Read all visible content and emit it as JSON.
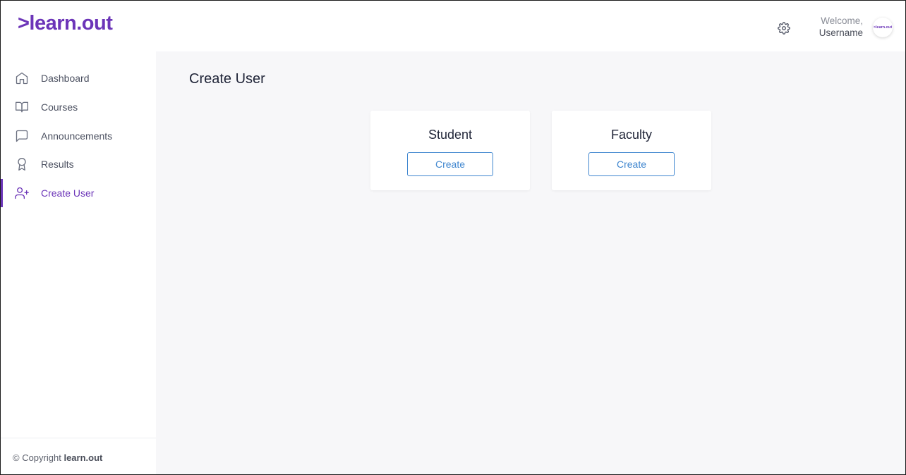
{
  "header": {
    "logo_text": ">learn.out",
    "welcome_line1": "Welcome,",
    "welcome_line2": "Username",
    "avatar_text": ">learn.out",
    "settings_icon": "gear-icon",
    "accent_color": "#6c35b8"
  },
  "sidebar": {
    "items": [
      {
        "label": "Dashboard",
        "icon": "home-icon",
        "active": false
      },
      {
        "label": "Courses",
        "icon": "book-open-icon",
        "active": false
      },
      {
        "label": "Announcements",
        "icon": "message-square-icon",
        "active": false
      },
      {
        "label": "Results",
        "icon": "award-icon",
        "active": false
      },
      {
        "label": "Create User",
        "icon": "user-plus-icon",
        "active": true
      }
    ],
    "footer_prefix": "© Copyright",
    "footer_brand": "learn.out"
  },
  "main": {
    "title": "Create User",
    "cards": [
      {
        "title": "Student",
        "button_label": "Create"
      },
      {
        "title": "Faculty",
        "button_label": "Create"
      }
    ],
    "button_color": "#3f86cf"
  }
}
